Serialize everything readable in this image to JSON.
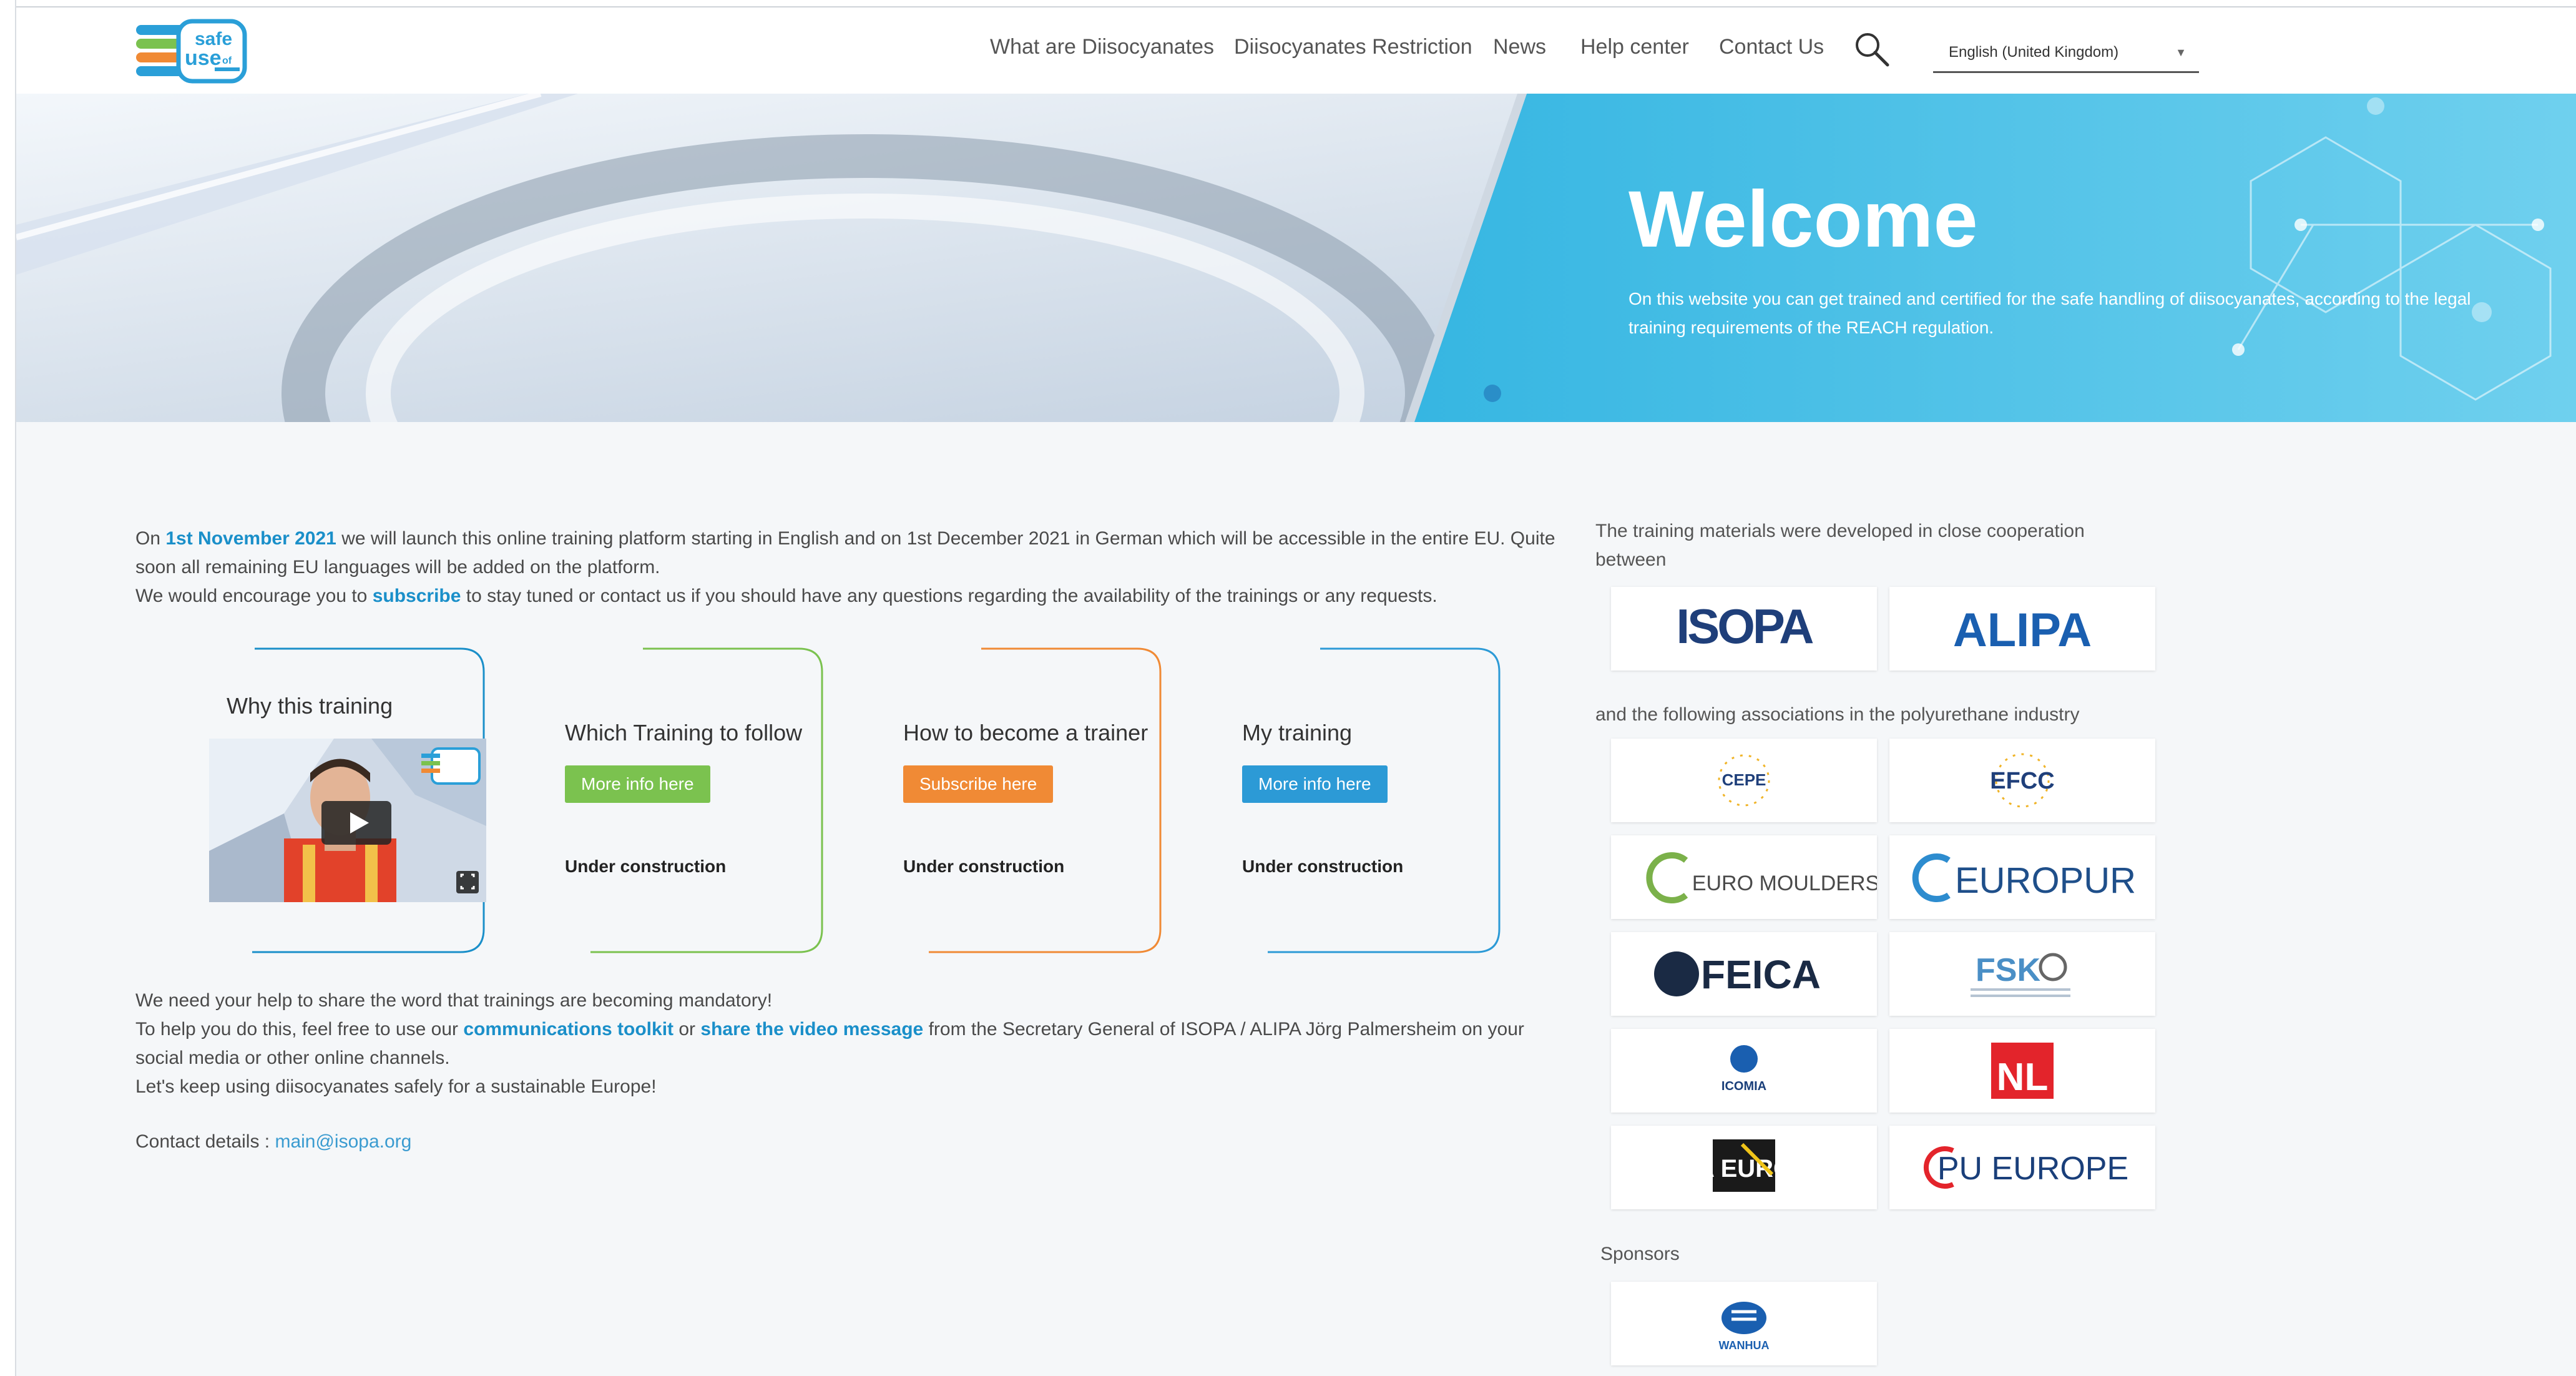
{
  "header": {
    "logo_alt": "safe use of diisocyanates",
    "nav": [
      {
        "label": "What are Diisocyanates"
      },
      {
        "label": "Diisocyanates Restriction"
      },
      {
        "label": "News"
      },
      {
        "label": "Help center"
      },
      {
        "label": "Contact Us"
      }
    ],
    "language": "English (United Kingdom)"
  },
  "hero": {
    "title": "Welcome",
    "subtitle": "On this website you can get trained and certified for the safe handling of diisocyanates, according to the legal training requirements of the REACH regulation."
  },
  "intro": {
    "p1_prefix": "On ",
    "p1_date": "1st November 2021",
    "p1_rest": " we will launch this online training platform starting in English and on 1st December 2021 in German which will be accessible in the entire EU. Quite soon all remaining EU languages will be added on the platform.",
    "p2_prefix": "We would encourage you to ",
    "p2_link": "subscribe",
    "p2_rest": " to stay tuned or contact us if you should have any questions regarding the availability of the trainings or any requests."
  },
  "cards": [
    {
      "title": "Why this training"
    },
    {
      "title": "Which Training to follow",
      "button": "More info here",
      "note": "Under construction"
    },
    {
      "title": "How to become a trainer",
      "button": "Subscribe here",
      "note": "Under construction"
    },
    {
      "title": "My training",
      "button": "More info here",
      "note": "Under construction"
    }
  ],
  "colors": {
    "blue": "#1a8fc9",
    "green": "#7bc24f",
    "orange": "#f08a35",
    "accent_blue": "#2c9ad6"
  },
  "share": {
    "line1": "We need your help to share the word that trainings are becoming mandatory!",
    "line2_prefix": "To help you do this, feel free to use our ",
    "line2_link1": "communications toolkit",
    "line2_mid": " or ",
    "line2_link2": "share the video message",
    "line2_rest": " from the Secretary General of ISOPA /  ALIPA Jörg Palmersheim on your social media or other online channels.",
    "line3": "Let's keep using diisocyanates safely for a sustainable Europe!"
  },
  "contact": {
    "label": "Contact details : ",
    "email": "main@isopa.org"
  },
  "right": {
    "coop_text": "The training materials were developed in close cooperation between",
    "assoc_text": "and the following associations in the polyurethane industry",
    "sponsors_text": "Sponsors",
    "partners": [
      "ISOPA",
      "ALIPA"
    ],
    "associations": [
      "CEPE",
      "EFCC",
      "EURO MOULDERS",
      "EUROPUR",
      "FEICA",
      "FSK",
      "ICOMIA",
      "NL",
      "PDA EUROPE",
      "PU EUROPE"
    ],
    "sponsors": [
      "WANHUA"
    ]
  }
}
